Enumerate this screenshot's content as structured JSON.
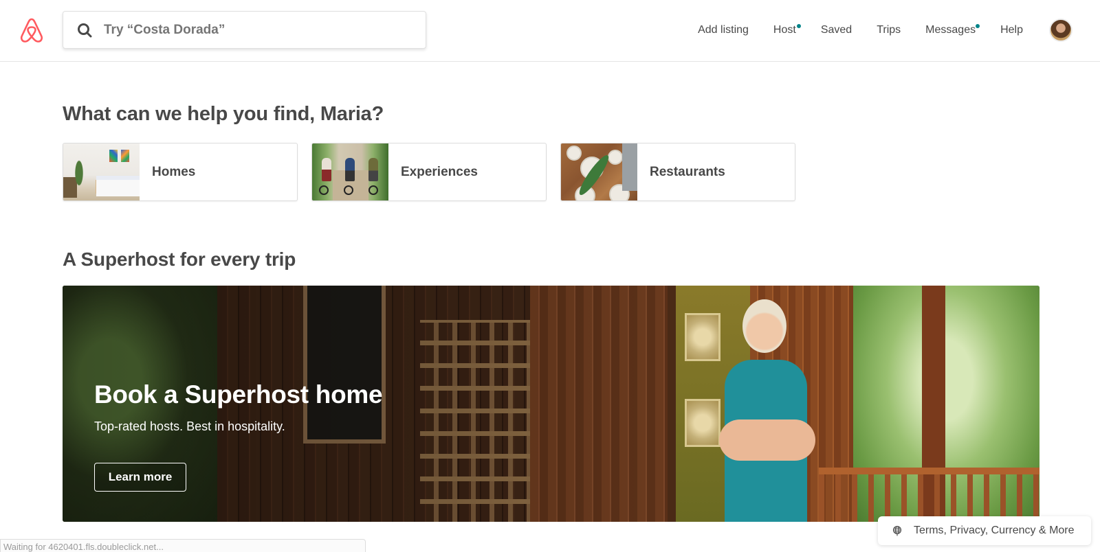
{
  "header": {
    "logo_name": "airbnb-logo",
    "search": {
      "placeholder": "Try “Costa Dorada”",
      "value": ""
    },
    "nav": [
      {
        "label": "Add listing",
        "has_dot": false
      },
      {
        "label": "Host",
        "has_dot": true
      },
      {
        "label": "Saved",
        "has_dot": false
      },
      {
        "label": "Trips",
        "has_dot": false
      },
      {
        "label": "Messages",
        "has_dot": true
      },
      {
        "label": "Help",
        "has_dot": false
      }
    ],
    "notification_dot_color": "#008489",
    "brand_color": "#FF5A5F"
  },
  "main": {
    "greeting": "What can we help you find, Maria?",
    "categories": [
      {
        "label": "Homes"
      },
      {
        "label": "Experiences"
      },
      {
        "label": "Restaurants"
      }
    ],
    "superhost_heading": "A Superhost for every trip",
    "banner": {
      "title": "Book a Superhost home",
      "subtitle": "Top-rated hosts. Best in hospitality.",
      "cta_label": "Learn more"
    }
  },
  "footer": {
    "links_label": "Terms, Privacy, Currency & More"
  },
  "browser_status": {
    "text": "Waiting for 4620401.fls.doubleclick.net..."
  }
}
